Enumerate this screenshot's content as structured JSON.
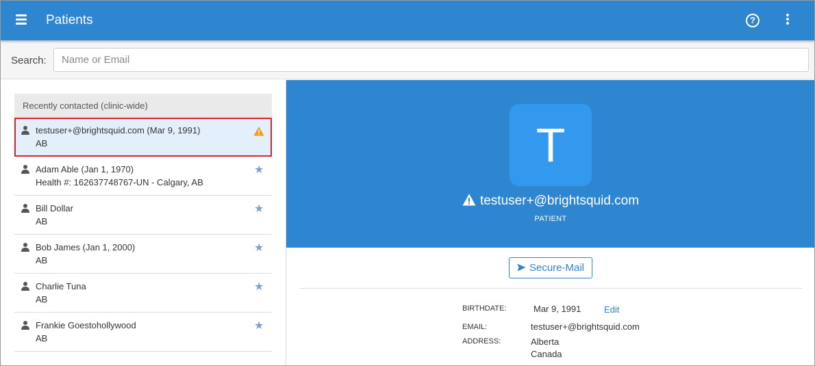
{
  "header": {
    "title": "Patients",
    "help_glyph": "?"
  },
  "search": {
    "label": "Search:",
    "placeholder": "Name or Email",
    "value": ""
  },
  "list": {
    "header": "Recently contacted (clinic-wide)",
    "items": [
      {
        "name": "testuser+@brightsquid.com (Mar 9, 1991)",
        "sub": "AB",
        "icon": "warning-icon",
        "selected": true
      },
      {
        "name": "Adam Able (Jan 1, 1970)",
        "sub": "Health #: 162637748767-UN - Calgary, AB",
        "icon": "star-icon",
        "selected": false
      },
      {
        "name": "Bill Dollar",
        "sub": "AB",
        "icon": "star-icon",
        "selected": false
      },
      {
        "name": "Bob James (Jan 1, 2000)",
        "sub": "AB",
        "icon": "star-icon",
        "selected": false
      },
      {
        "name": "Charlie Tuna",
        "sub": "AB",
        "icon": "star-icon",
        "selected": false
      },
      {
        "name": "Frankie Goestohollywood",
        "sub": "AB",
        "icon": "star-icon",
        "selected": false
      }
    ]
  },
  "profile": {
    "initial": "T",
    "email": "testuser+@brightsquid.com",
    "role": "PATIENT",
    "secure_mail_label": "Secure-Mail",
    "birthdate_label": "BIRTHDATE:",
    "birthdate": "Mar 9, 1991",
    "edit_label": "Edit",
    "email_label": "EMAIL:",
    "email_value": "testuser+@brightsquid.com",
    "address_label": "ADDRESS:",
    "address_line1": "Alberta",
    "address_line2": "Canada"
  },
  "colors": {
    "primary": "#2f86d0",
    "avatar": "#3399ee",
    "warning": "#f39c12",
    "star": "#7f9fcf",
    "selection_border": "#d8252c"
  }
}
